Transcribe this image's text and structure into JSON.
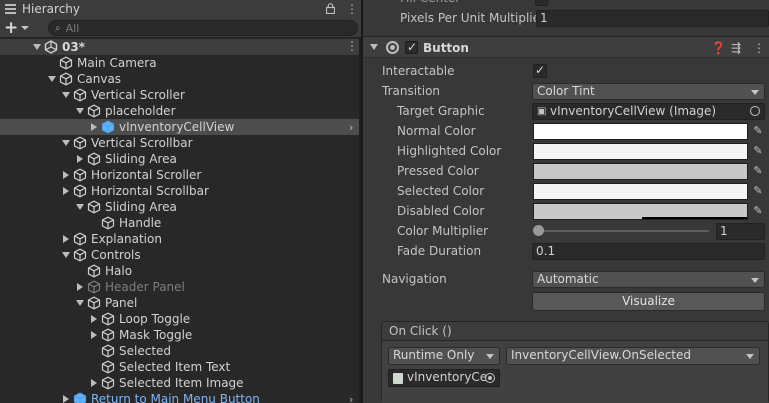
{
  "hierarchy": {
    "tab_title": "Hierarchy",
    "search": {
      "placeholder": "All"
    },
    "add_label": "+",
    "rows": [
      {
        "label": "03*",
        "kind": "scene"
      },
      {
        "label": "Main Camera"
      },
      {
        "label": "Canvas"
      },
      {
        "label": "Vertical Scroller"
      },
      {
        "label": "placeholder"
      },
      {
        "label": "vInventoryCellView",
        "selected": true
      },
      {
        "label": "Vertical Scrollbar"
      },
      {
        "label": "Sliding Area"
      },
      {
        "label": "Horizontal Scroller"
      },
      {
        "label": "Horizontal Scrollbar"
      },
      {
        "label": "Sliding Area"
      },
      {
        "label": "Handle"
      },
      {
        "label": "Explanation"
      },
      {
        "label": "Controls"
      },
      {
        "label": "Halo"
      },
      {
        "label": "Header Panel",
        "dim": true
      },
      {
        "label": "Panel"
      },
      {
        "label": "Loop Toggle"
      },
      {
        "label": "Mask Toggle"
      },
      {
        "label": "Selected"
      },
      {
        "label": "Selected Item Text"
      },
      {
        "label": "Selected Item Image"
      },
      {
        "label": "Return to Main Menu Button",
        "prefab": true
      }
    ]
  },
  "inspector": {
    "cut_label": "Fill Center",
    "ppu_label": "Pixels Per Unit Multiplier",
    "ppu_value": "1",
    "component_title": "Button",
    "interactable_label": "Interactable",
    "transition_label": "Transition",
    "transition_value": "Color Tint",
    "target_graphic_label": "Target Graphic",
    "target_graphic_value": "vInventoryCellView (Image)",
    "normal_color_label": "Normal Color",
    "highlighted_color_label": "Highlighted Color",
    "pressed_color_label": "Pressed Color",
    "selected_color_label": "Selected Color",
    "disabled_color_label": "Disabled Color",
    "color_multiplier_label": "Color Multiplier",
    "color_multiplier_value": "1",
    "color_multiplier_fraction": 0.0,
    "fade_duration_label": "Fade Duration",
    "fade_duration_value": "0.1",
    "navigation_label": "Navigation",
    "navigation_value": "Automatic",
    "visualize_label": "Visualize",
    "onclick_title": "On Click ()",
    "onclick_runtime": "Runtime Only",
    "onclick_method": "InventoryCellView.OnSelected",
    "onclick_target": "vInventoryCe",
    "colors": {
      "normal": "#ffffff",
      "highlighted": "#f5f5f5",
      "pressed": "#c8c8c8",
      "selected": "#f5f5f5",
      "disabled": "#c8c8c8",
      "selected_row": "#4d4d4d",
      "prefab_text": "#7eb6f5"
    }
  }
}
